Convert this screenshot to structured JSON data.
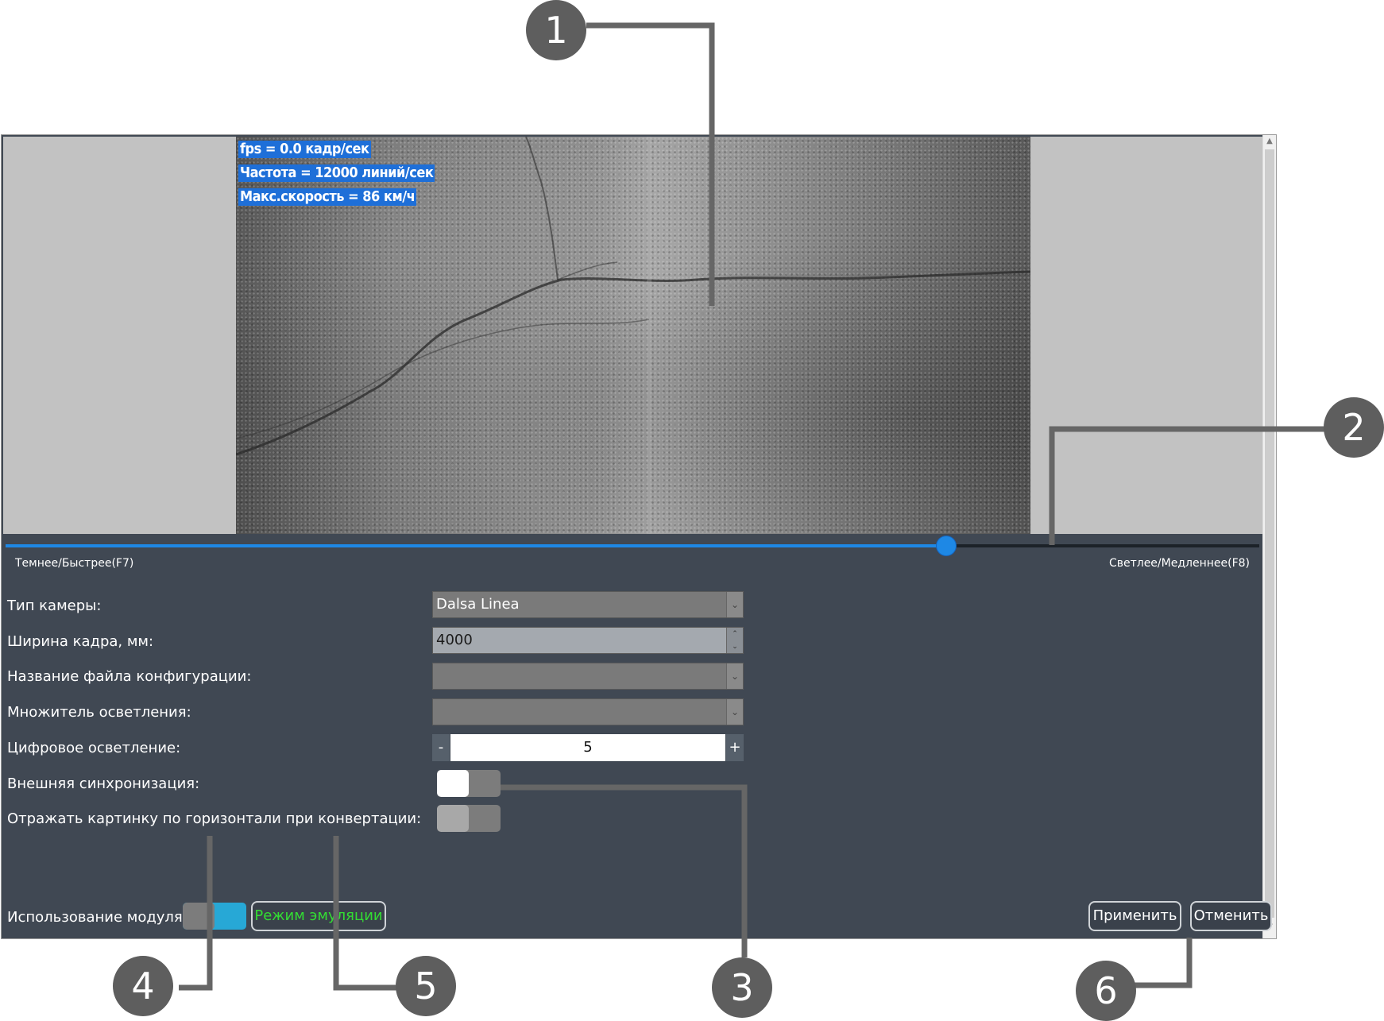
{
  "overlay": {
    "fps": "fps = 0.0 кадр/сек",
    "frequency": "Частота = 12000 линий/сек",
    "max_speed": "Макс.скорость = 86 км/ч"
  },
  "slider": {
    "left_label": "Темнее/Быстрее(F7)",
    "right_label": "Светлее/Медленнее(F8)",
    "value_fraction": 0.75
  },
  "form": {
    "camera_type_label": "Тип камеры:",
    "camera_type_value": "Dalsa Linea",
    "frame_width_label": "Ширина кадра, мм:",
    "frame_width_value": "4000",
    "config_file_label": "Название файла конфигурации:",
    "config_file_value": "",
    "brightness_multiplier_label": "Множитель осветления:",
    "brightness_multiplier_value": "",
    "digital_brightening_label": "Цифровое осветление:",
    "digital_brightening_value": "5",
    "digital_brightening_minus": "-",
    "digital_brightening_plus": "+",
    "external_sync_label": "Внешняя синхронизация:",
    "mirror_label": "Отражать картинку по горизонтали при конвертации:"
  },
  "footer": {
    "module_usage_label": "Использование модуля",
    "emulation_button": "Режим эмуляции",
    "apply_button": "Применить",
    "cancel_button": "Отменить"
  },
  "callouts": [
    "1",
    "2",
    "3",
    "4",
    "5",
    "6"
  ],
  "colors": {
    "panel_bg": "#404853",
    "accent_blue": "#1e88e5",
    "toggle_active": "#27a8d6",
    "emulation_text": "#33dd33",
    "callout_badge": "#5e5e5e"
  }
}
